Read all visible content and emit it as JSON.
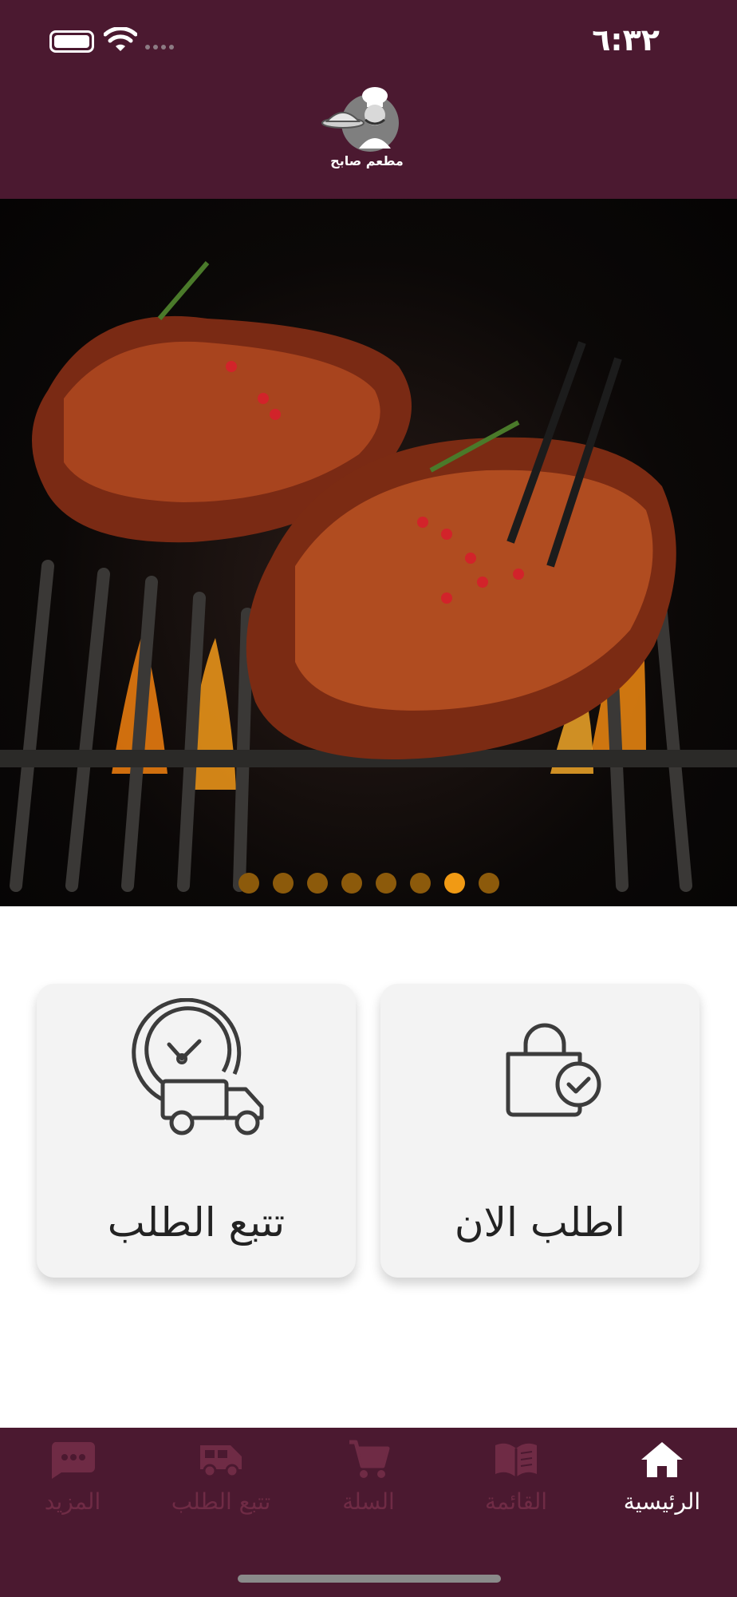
{
  "status_bar": {
    "time": "٦:٣٢",
    "battery_icon": "battery-icon",
    "wifi_icon": "wifi-icon"
  },
  "header": {
    "logo_text": "مطعم صابح",
    "logo_icon": "chef-logo-icon",
    "background": "#4b1930"
  },
  "banner": {
    "image": "grilled-steaks-photo",
    "slide_count": 8,
    "active_slide": 7
  },
  "actions": {
    "track_order_label": "تتبع الطلب",
    "track_order_icon": "delivery-clock-icon",
    "order_now_label": "اطلب الان",
    "order_now_icon": "shopping-bag-check-icon"
  },
  "bottom_nav": {
    "items": [
      {
        "label": "المزيد",
        "icon": "more-chat-icon",
        "active": false
      },
      {
        "label": "تتبع الطلب",
        "icon": "truck-icon",
        "active": false
      },
      {
        "label": "السلة",
        "icon": "cart-icon",
        "active": false
      },
      {
        "label": "القائمة",
        "icon": "menu-book-icon",
        "active": false
      },
      {
        "label": "الرئيسية",
        "icon": "home-icon",
        "active": true
      }
    ]
  },
  "colors": {
    "brand": "#4b1930",
    "dot_active": "#f19a14",
    "dot_inactive": "#8c5a0b",
    "nav_inactive": "#6f2b45"
  }
}
